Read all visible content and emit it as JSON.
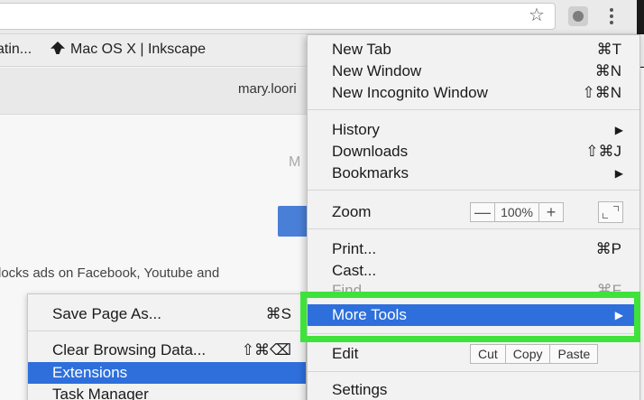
{
  "bookmarks_bar": {
    "item1": "atin...",
    "item2": "Mac OS X | Inkscape"
  },
  "page": {
    "email": "mary.loori",
    "letter": "M",
    "ad_text": "locks ads on Facebook, Youtube and"
  },
  "menu": {
    "new_tab": {
      "label": "New Tab",
      "shortcut": "⌘T"
    },
    "new_window": {
      "label": "New Window",
      "shortcut": "⌘N"
    },
    "new_incognito": {
      "label": "New Incognito Window",
      "shortcut": "⇧⌘N"
    },
    "history": {
      "label": "History"
    },
    "downloads": {
      "label": "Downloads",
      "shortcut": "⇧⌘J"
    },
    "bookmarks": {
      "label": "Bookmarks"
    },
    "zoom": {
      "label": "Zoom",
      "minus": "—",
      "value": "100%",
      "plus": "+"
    },
    "print": {
      "label": "Print...",
      "shortcut": "⌘P"
    },
    "cast": {
      "label": "Cast..."
    },
    "find": {
      "label": "Find...",
      "shortcut": "⌘F"
    },
    "more_tools": {
      "label": "More Tools"
    },
    "edit": {
      "label": "Edit",
      "cut": "Cut",
      "copy": "Copy",
      "paste": "Paste"
    },
    "settings": {
      "label": "Settings"
    }
  },
  "submenu": {
    "save_page": {
      "label": "Save Page As...",
      "shortcut": "⌘S"
    },
    "clear_data": {
      "label": "Clear Browsing Data...",
      "shortcut": "⇧⌘⌫"
    },
    "extensions": {
      "label": "Extensions"
    },
    "task_manager": {
      "label": "Task Manager"
    }
  },
  "colors": {
    "highlight": "#2e6fdc",
    "green_outline": "#3ee23b"
  },
  "icons": {
    "star": "star-icon",
    "extension": "extension-icon",
    "menu": "kebab-menu-icon",
    "inkscape": "inkscape-icon",
    "fullscreen": "fullscreen-icon"
  }
}
